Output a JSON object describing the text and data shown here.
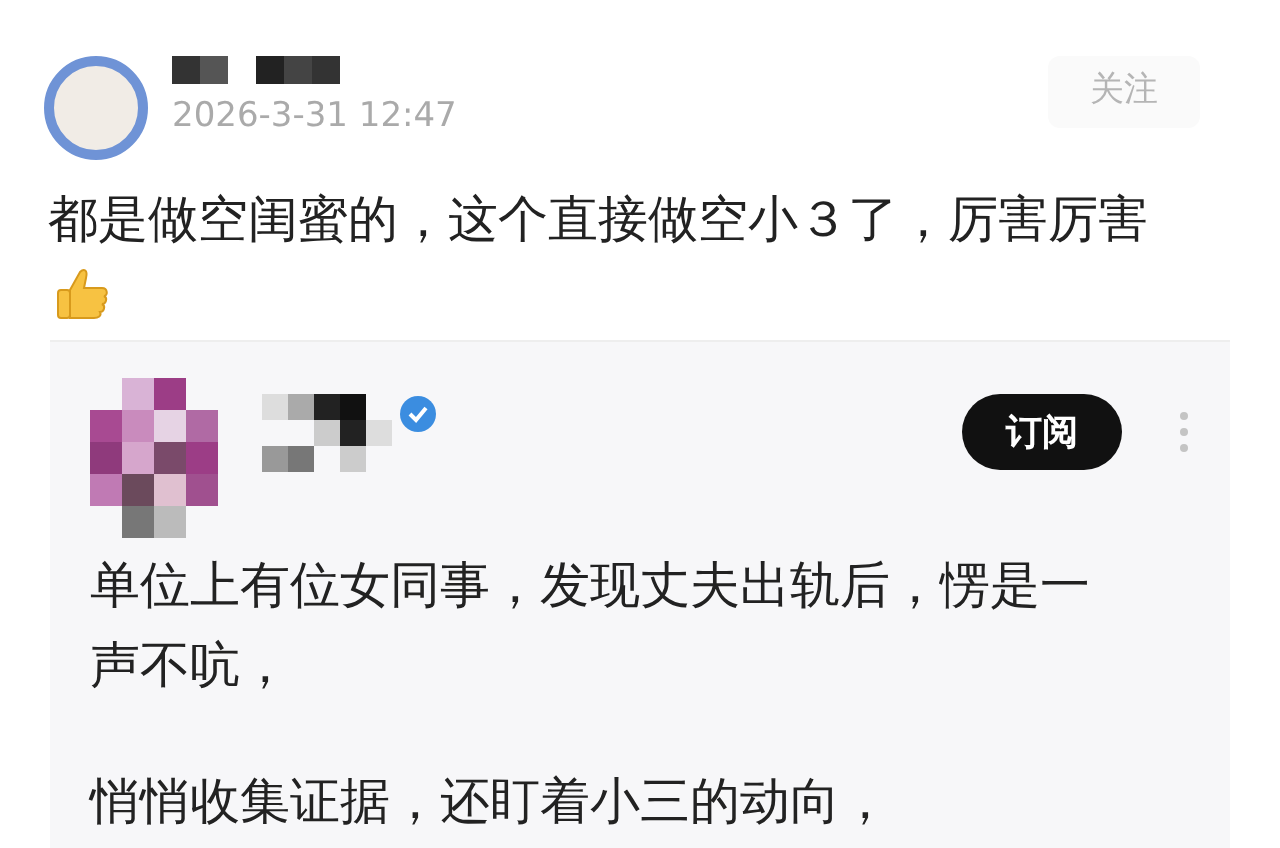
{
  "post": {
    "timestamp": "2026-3-31 12:47",
    "follow_button": "关注",
    "text": "都是做空闺蜜的，这个直接做空小３了，厉害厉害"
  },
  "quoted_post": {
    "verified": true,
    "subscribe_button": "订阅",
    "paragraphs": [
      "单位上有位女同事，发现丈夫出轨后，愣是一声不吭，",
      "悄悄收集证据，还盯着小三的动向，"
    ]
  }
}
